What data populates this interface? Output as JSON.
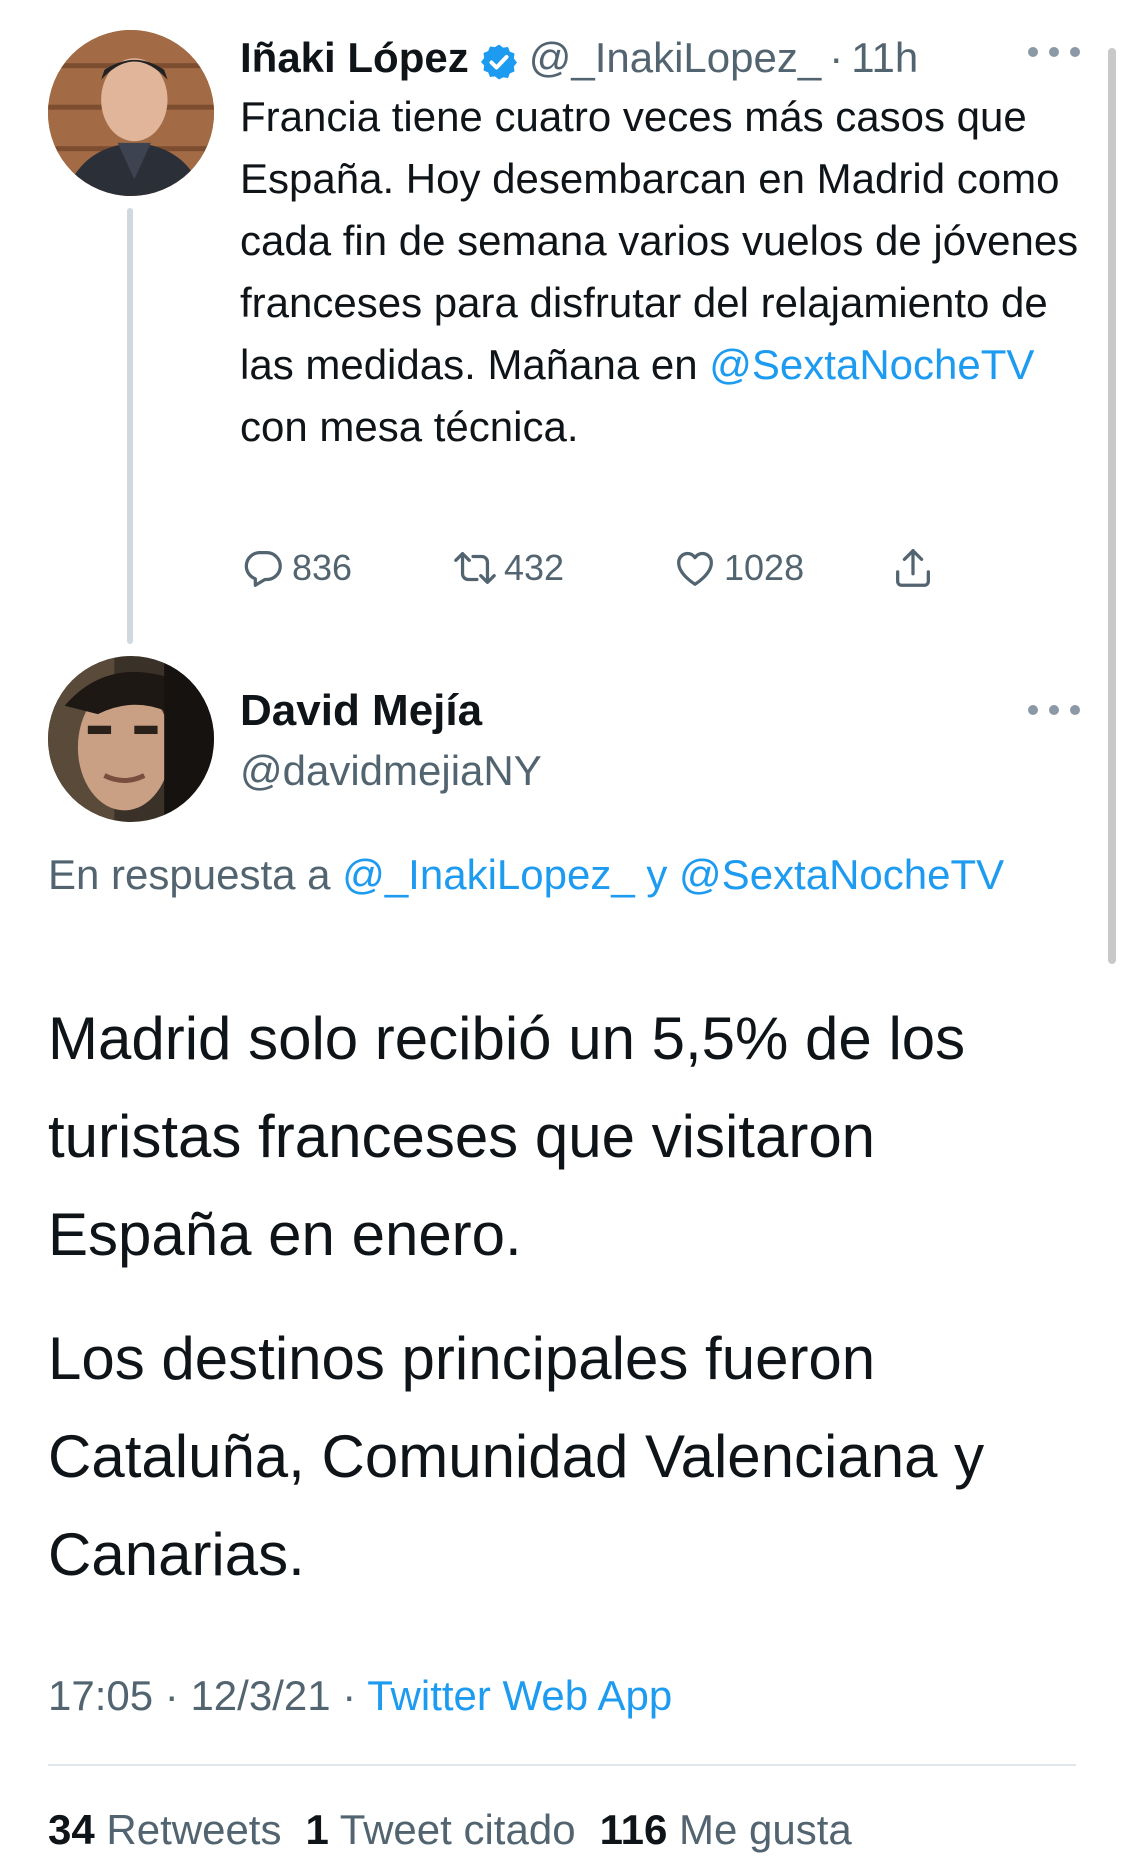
{
  "parent_tweet": {
    "author_name": "Iñaki López",
    "handle": "@_InakiLopez_",
    "separator": "·",
    "time": "11h",
    "text_before_mention": "Francia tiene cuatro veces más casos que España. Hoy desembarcan en Madrid como cada fin de semana varios vuelos de jóvenes franceses para disfrutar del relajamiento de las medidas. Mañana en ",
    "mention": "@SextaNocheTV",
    "text_after_mention": " con mesa técnica.",
    "replies": "836",
    "retweets": "432",
    "likes": "1028"
  },
  "reply_tweet": {
    "author_name": "David Mejía",
    "handle": "@davidmejiaNY",
    "reply_prefix": "En respuesta a ",
    "reply_mention_1": "@_InakiLopez_",
    "reply_joiner": " y ",
    "reply_mention_2": "@SextaNocheTV",
    "paragraph_1": "Madrid solo recibió un 5,5% de los turistas franceses que visitaron España en enero.",
    "paragraph_2": "Los destinos principales fueron Cataluña, Comunidad Valenciana y Canarias.",
    "time": "17:05",
    "separator": "·",
    "date": "12/3/21",
    "source": "Twitter Web App",
    "retweets_count": "34",
    "retweets_label": "Retweets",
    "quotes_count": "1",
    "quotes_label": "Tweet citado",
    "likes_count": "116",
    "likes_label": "Me gusta"
  },
  "colors": {
    "accent": "#1d9bf0",
    "secondary_text": "#536471",
    "primary_text": "#0f1419"
  },
  "icons": [
    "verified-badge-icon",
    "more-options-icon",
    "reply-icon",
    "retweet-icon",
    "like-icon",
    "share-icon"
  ]
}
